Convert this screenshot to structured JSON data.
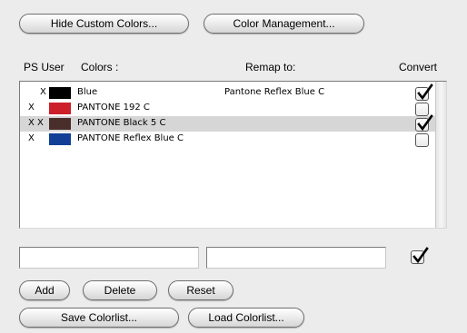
{
  "top_buttons": {
    "hide_custom": "Hide Custom Colors...",
    "color_management": "Color Management..."
  },
  "headers": {
    "ps_user": "PS User",
    "colors": "Colors :",
    "remap_to": "Remap to:",
    "convert": "Convert"
  },
  "rows": [
    {
      "mark": "X",
      "swatch": "#000000",
      "name": "Blue",
      "remap": "Pantone Reflex Blue C",
      "convert": true,
      "selected": false
    },
    {
      "mark": "X",
      "swatch": "#cc1f2a",
      "name": "PANTONE 192 C",
      "remap": "",
      "convert": false,
      "selected": false
    },
    {
      "mark": "X X",
      "swatch": "#4a2e2b",
      "name": "PANTONE Black 5 C",
      "remap": "",
      "convert": true,
      "selected": true
    },
    {
      "mark": "X",
      "swatch": "#123f96",
      "name": "PANTONE Reflex Blue C",
      "remap": "",
      "convert": false,
      "selected": false
    }
  ],
  "inputs": {
    "name_value": "",
    "remap_value": "",
    "convert_checked": true
  },
  "buttons": {
    "add": "Add",
    "delete": "Delete",
    "reset": "Reset",
    "save_colorlist": "Save Colorlist...",
    "load_colorlist": "Load Colorlist..."
  }
}
